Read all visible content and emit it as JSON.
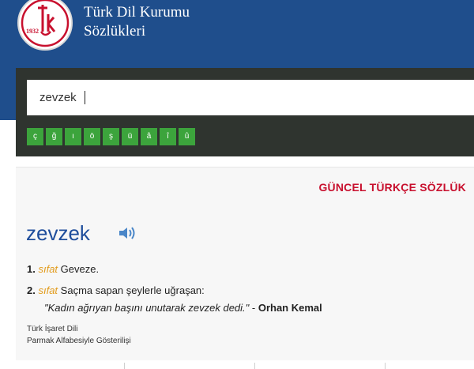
{
  "header": {
    "logo_year": "1932",
    "title_line1": "Türk Dil Kurumu",
    "title_line2": "Sözlükleri"
  },
  "search": {
    "value": "zevzek"
  },
  "special_keys": [
    "ç",
    "ğ",
    "ı",
    "ö",
    "ş",
    "ü",
    "â",
    "î",
    "û"
  ],
  "result": {
    "dictionary": "GÜNCEL TÜRKÇE SÖZLÜK",
    "word": "zevzek",
    "meanings": [
      {
        "num": "1.",
        "pos": "sıfat",
        "text": "Geveze."
      },
      {
        "num": "2.",
        "pos": "sıfat",
        "text": "Saçma sapan şeylerle uğraşan:",
        "example": "\"Kadın ağrıyan başını unutarak zevzek dedi.\"",
        "sep": " - ",
        "author": "Orhan Kemal"
      }
    ],
    "sign_language": "Türk İşaret Dili",
    "finger_alphabet": "Parmak Alfabesiyle Gösterilişi"
  },
  "colors": {
    "header_bg": "#1f4e8c",
    "search_panel_bg": "#2f342f",
    "key_bg": "#3ca43c",
    "dict_title": "#c8102e",
    "word": "#1f4e9c",
    "pos": "#e29b1b"
  },
  "icons": {
    "speaker": "speaker-icon",
    "logo": "tdk-logo"
  }
}
